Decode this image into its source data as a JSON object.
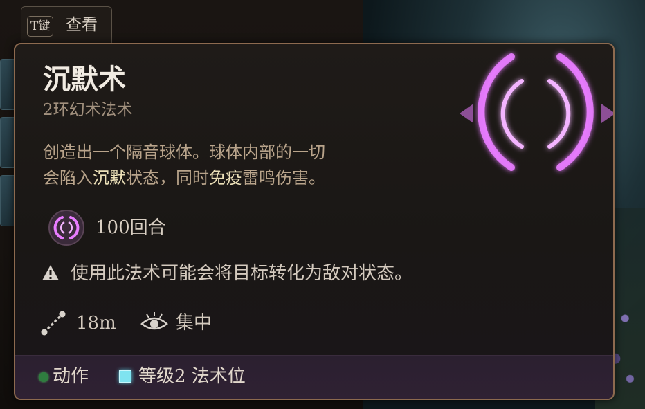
{
  "hint": {
    "key": "T键",
    "label": "查看"
  },
  "spell": {
    "name": "沉默术",
    "subtitle": "2环幻术法术",
    "description": {
      "p1": "创造出一个隔音球体。球体内部的一切",
      "p2": "会陷入",
      "kw1": "沉默",
      "p3": "状态，同时",
      "kw2": "免疫",
      "p4": "雷鸣伤害。"
    },
    "duration": "100回合",
    "warning": "使用此法术可能会将目标转化为敌对状态。",
    "range": "18m",
    "concentration": "集中"
  },
  "footer": {
    "action": "动作",
    "slot": "等级2 法术位"
  },
  "colors": {
    "accent_border": "#8d6a4f",
    "spell_glow": "#e06bff",
    "action_dot": "#2f7d3f",
    "slot_square": "#7fe3f0",
    "keyword": "#ece0b8"
  },
  "icons": {
    "spell_art": "silence-sphere-icon",
    "duration": "silence-spell-icon",
    "warning": "warning-triangle-icon",
    "range": "range-dotted-line-icon",
    "concentration": "concentration-eye-icon"
  }
}
